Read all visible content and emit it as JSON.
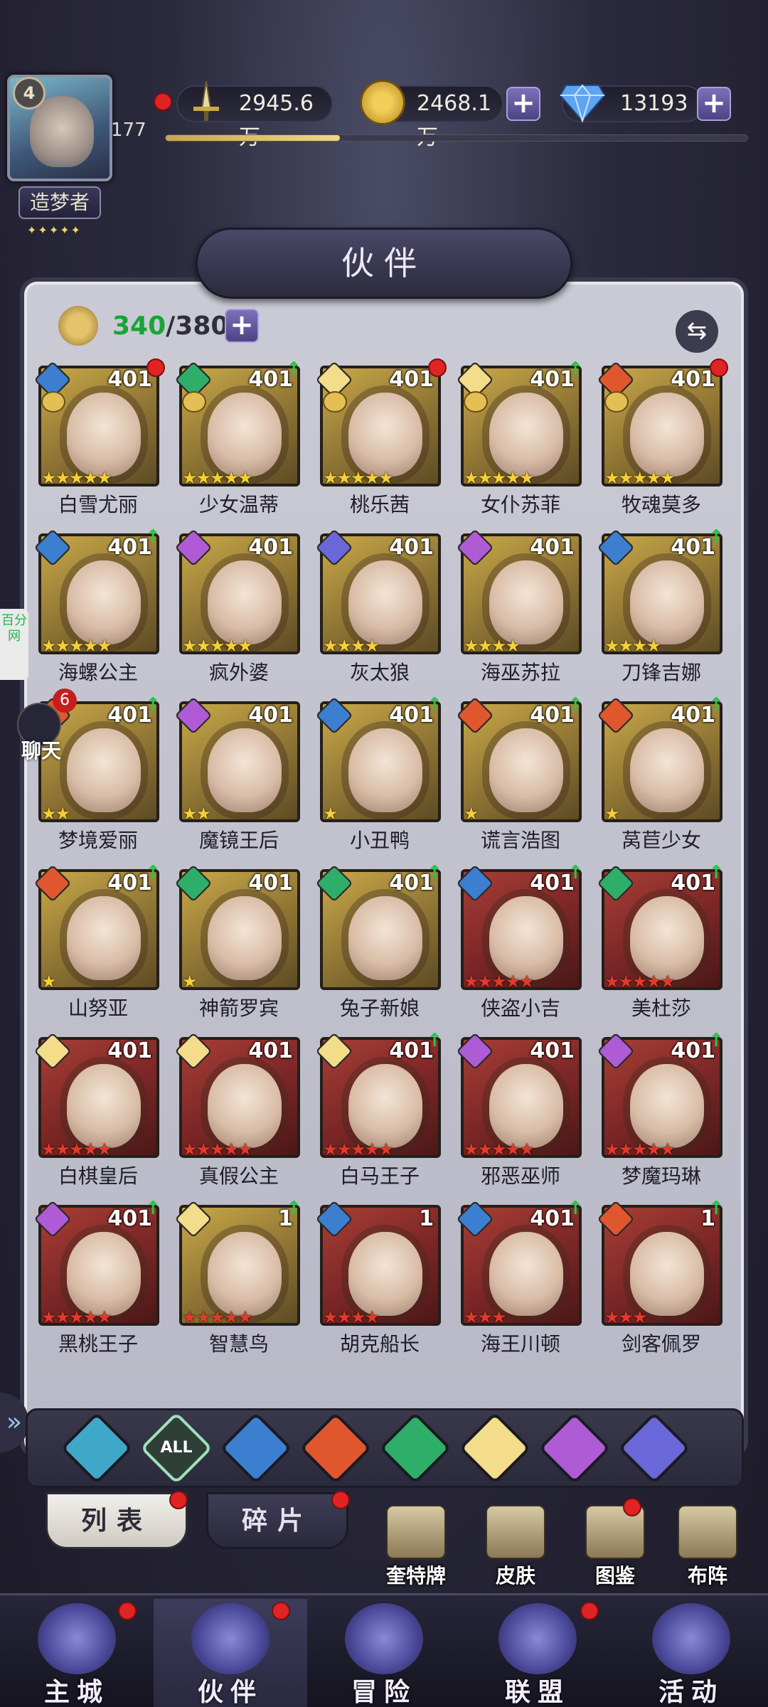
{
  "player": {
    "level": "4",
    "level_num": "177",
    "title": "造梦者",
    "title_stars": "✦✦✦✦✦",
    "exp_fraction": 0.3
  },
  "resources": {
    "power": "2945.6万",
    "gold": "2468.1万",
    "diamond": "13193"
  },
  "panel": {
    "title": "伙伴",
    "count_current": "340",
    "count_max": "/380"
  },
  "side": {
    "side_tab": "百分网",
    "chat_count": "6",
    "chat_label": "聊天"
  },
  "characters": [
    {
      "name": "白雪尤丽",
      "level": "401",
      "element": "water",
      "frame": "gold",
      "stars": 5,
      "star_color": "y",
      "crest": true,
      "badge": "dot"
    },
    {
      "name": "少女温蒂",
      "level": "401",
      "element": "wind",
      "frame": "gold",
      "stars": 5,
      "star_color": "y",
      "crest": true,
      "badge": "up"
    },
    {
      "name": "桃乐茜",
      "level": "401",
      "element": "light",
      "frame": "gold",
      "stars": 5,
      "star_color": "y",
      "crest": true,
      "badge": "dot"
    },
    {
      "name": "女仆苏菲",
      "level": "401",
      "element": "light",
      "frame": "gold",
      "stars": 5,
      "star_color": "y",
      "crest": true,
      "badge": "up"
    },
    {
      "name": "牧魂莫多",
      "level": "401",
      "element": "fire",
      "frame": "gold",
      "stars": 5,
      "star_color": "y",
      "crest": true,
      "badge": "dot"
    },
    {
      "name": "海螺公主",
      "level": "401",
      "element": "water",
      "frame": "gold",
      "stars": 5,
      "star_color": "y",
      "crest": false,
      "badge": "up"
    },
    {
      "name": "疯外婆",
      "level": "401",
      "element": "dark",
      "frame": "gold",
      "stars": 5,
      "star_color": "y",
      "crest": false,
      "badge": ""
    },
    {
      "name": "灰太狼",
      "level": "401",
      "element": "planet",
      "frame": "gold",
      "stars": 4,
      "star_color": "y",
      "crest": false,
      "badge": ""
    },
    {
      "name": "海巫苏拉",
      "level": "401",
      "element": "dark",
      "frame": "gold",
      "stars": 4,
      "star_color": "y",
      "crest": false,
      "badge": ""
    },
    {
      "name": "刀锋吉娜",
      "level": "401",
      "element": "water",
      "frame": "gold",
      "stars": 4,
      "star_color": "y",
      "crest": false,
      "badge": "up"
    },
    {
      "name": "梦境爱丽",
      "level": "401",
      "element": "fire",
      "frame": "gold",
      "stars": 2,
      "star_color": "y",
      "crest": false,
      "badge": "up"
    },
    {
      "name": "魔镜王后",
      "level": "401",
      "element": "dark",
      "frame": "gold",
      "stars": 2,
      "star_color": "y",
      "crest": false,
      "badge": ""
    },
    {
      "name": "小丑鸭",
      "level": "401",
      "element": "water",
      "frame": "gold",
      "stars": 1,
      "star_color": "y",
      "crest": false,
      "badge": "up"
    },
    {
      "name": "谎言浩图",
      "level": "401",
      "element": "fire",
      "frame": "gold",
      "stars": 1,
      "star_color": "y",
      "crest": false,
      "badge": "up"
    },
    {
      "name": "莴苣少女",
      "level": "401",
      "element": "fire",
      "frame": "gold",
      "stars": 1,
      "star_color": "y",
      "crest": false,
      "badge": "up"
    },
    {
      "name": "山努亚",
      "level": "401",
      "element": "fire",
      "frame": "gold",
      "stars": 1,
      "star_color": "y",
      "crest": false,
      "badge": "up"
    },
    {
      "name": "神箭罗宾",
      "level": "401",
      "element": "wind",
      "frame": "gold",
      "stars": 1,
      "star_color": "y",
      "crest": false,
      "badge": ""
    },
    {
      "name": "兔子新娘",
      "level": "401",
      "element": "wind",
      "frame": "gold",
      "stars": 0,
      "star_color": "y",
      "crest": false,
      "badge": "up"
    },
    {
      "name": "侠盗小吉",
      "level": "401",
      "element": "water",
      "frame": "red",
      "stars": 5,
      "star_color": "r",
      "crest": false,
      "badge": "up"
    },
    {
      "name": "美杜莎",
      "level": "401",
      "element": "wind",
      "frame": "red",
      "stars": 5,
      "star_color": "r",
      "crest": false,
      "badge": "up"
    },
    {
      "name": "白棋皇后",
      "level": "401",
      "element": "light",
      "frame": "red",
      "stars": 5,
      "star_color": "r",
      "crest": false,
      "badge": ""
    },
    {
      "name": "真假公主",
      "level": "401",
      "element": "light",
      "frame": "red",
      "stars": 5,
      "star_color": "r",
      "crest": false,
      "badge": ""
    },
    {
      "name": "白马王子",
      "level": "401",
      "element": "light",
      "frame": "red",
      "stars": 5,
      "star_color": "r",
      "crest": false,
      "badge": "up"
    },
    {
      "name": "邪恶巫师",
      "level": "401",
      "element": "dark",
      "frame": "red",
      "stars": 5,
      "star_color": "r",
      "crest": false,
      "badge": ""
    },
    {
      "name": "梦魔玛琳",
      "level": "401",
      "element": "dark",
      "frame": "red",
      "stars": 5,
      "star_color": "r",
      "crest": false,
      "badge": "up"
    },
    {
      "name": "黑桃王子",
      "level": "401",
      "element": "dark",
      "frame": "red",
      "stars": 5,
      "star_color": "r",
      "crest": false,
      "badge": "up"
    },
    {
      "name": "智慧鸟",
      "level": "1",
      "element": "light",
      "frame": "gold",
      "stars": 5,
      "star_color": "r",
      "crest": false,
      "badge": "up"
    },
    {
      "name": "胡克船长",
      "level": "1",
      "element": "water",
      "frame": "red",
      "stars": 4,
      "star_color": "r",
      "crest": false,
      "badge": ""
    },
    {
      "name": "海王川顿",
      "level": "401",
      "element": "water",
      "frame": "red",
      "stars": 3,
      "star_color": "r",
      "crest": false,
      "badge": "up"
    },
    {
      "name": "剑客佩罗",
      "level": "1",
      "element": "fire",
      "frame": "red",
      "stars": 3,
      "star_color": "r",
      "crest": false,
      "badge": "up"
    }
  ],
  "filters": [
    {
      "key": "planet-up",
      "color": "#3fa7c8",
      "label": ""
    },
    {
      "key": "all",
      "color": "#2e3f38",
      "label": "ALL"
    },
    {
      "key": "water",
      "color": "#3c7fd0",
      "label": ""
    },
    {
      "key": "fire",
      "color": "#e0572d",
      "label": ""
    },
    {
      "key": "wind",
      "color": "#2fae6a",
      "label": ""
    },
    {
      "key": "light",
      "color": "#f3dd8b",
      "label": ""
    },
    {
      "key": "dark",
      "color": "#b05bd6",
      "label": ""
    },
    {
      "key": "planet",
      "color": "#6a68d8",
      "label": ""
    }
  ],
  "subtabs": {
    "list": "列表",
    "fragments": "碎片"
  },
  "quick_actions": [
    "奎特牌",
    "皮肤",
    "图鉴",
    "布阵"
  ],
  "nav": [
    "主城",
    "伙伴",
    "冒险",
    "联盟",
    "活动"
  ]
}
